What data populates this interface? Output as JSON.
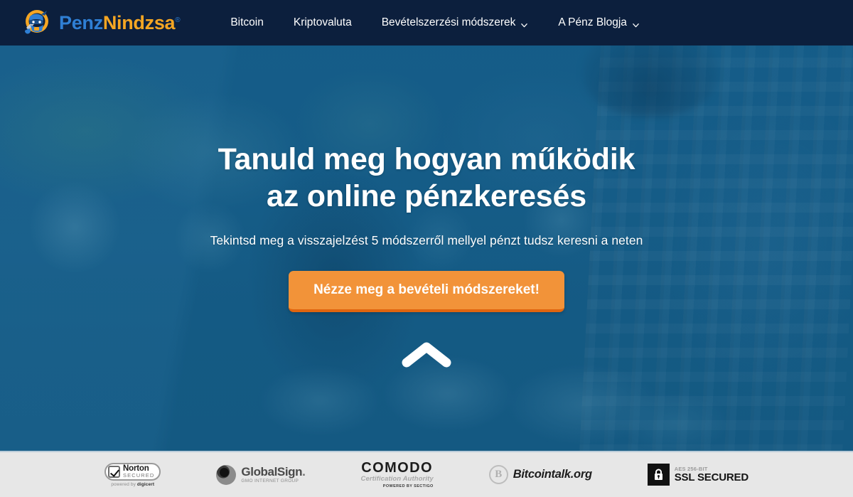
{
  "header": {
    "logo": {
      "icon": "ninja-mascot-icon",
      "text_primary": "Penz",
      "text_accent": "Nindzsa",
      "registered_mark": "®",
      "color_primary": "#2f7fd4",
      "color_accent": "#f5a623"
    },
    "background_color": "#0c1f3d",
    "nav": [
      {
        "label": "Bitcoin",
        "has_dropdown": false
      },
      {
        "label": "Kriptovaluta",
        "has_dropdown": false
      },
      {
        "label": "Bevételszerzési módszerek",
        "has_dropdown": true,
        "caret": "chevron-down-icon"
      },
      {
        "label": "A Pénz Blogja",
        "has_dropdown": true,
        "caret": "chevron-down-icon"
      }
    ]
  },
  "hero": {
    "title_line1": "Tanuld meg hogyan működik",
    "title_line2": "az online pénzkeresés",
    "subtitle": "Tekintsd meg a visszajelzést 5 módszerről mellyel pénzt tudsz keresni a neten",
    "cta_label": "Nézze meg a bevételi módszereket!",
    "cta_color": "#f29339",
    "cta_shadow_color": "#e0650f",
    "scroll_icon": "chevron-up-icon",
    "background_color": "#155b85"
  },
  "badges": {
    "strip_background": "#e7e7e7",
    "items": [
      {
        "id": "norton-secured-badge",
        "name": "Norton",
        "secured": "SECURED",
        "powered_prefix": "powered by ",
        "powered_brand": "digicert",
        "icon": "checkmark-icon"
      },
      {
        "id": "globalsign-badge",
        "name": "GlobalSign",
        "name_dot": ".",
        "subtitle": "GMO INTERNET GROUP",
        "icon": "globalsign-orb-icon"
      },
      {
        "id": "comodo-badge",
        "name": "COMODO",
        "subtitle": "Certification Authority",
        "powered": "POWERED BY SECTIGO"
      },
      {
        "id": "bitcointalk-badge",
        "name": "Bitcointalk.org",
        "icon": "bitcoin-icon",
        "icon_glyph": "B"
      },
      {
        "id": "ssl-secured-badge",
        "top_label": "AES 256-BIT",
        "main_label": "SSL SECURED",
        "icon": "padlock-icon"
      }
    ]
  }
}
